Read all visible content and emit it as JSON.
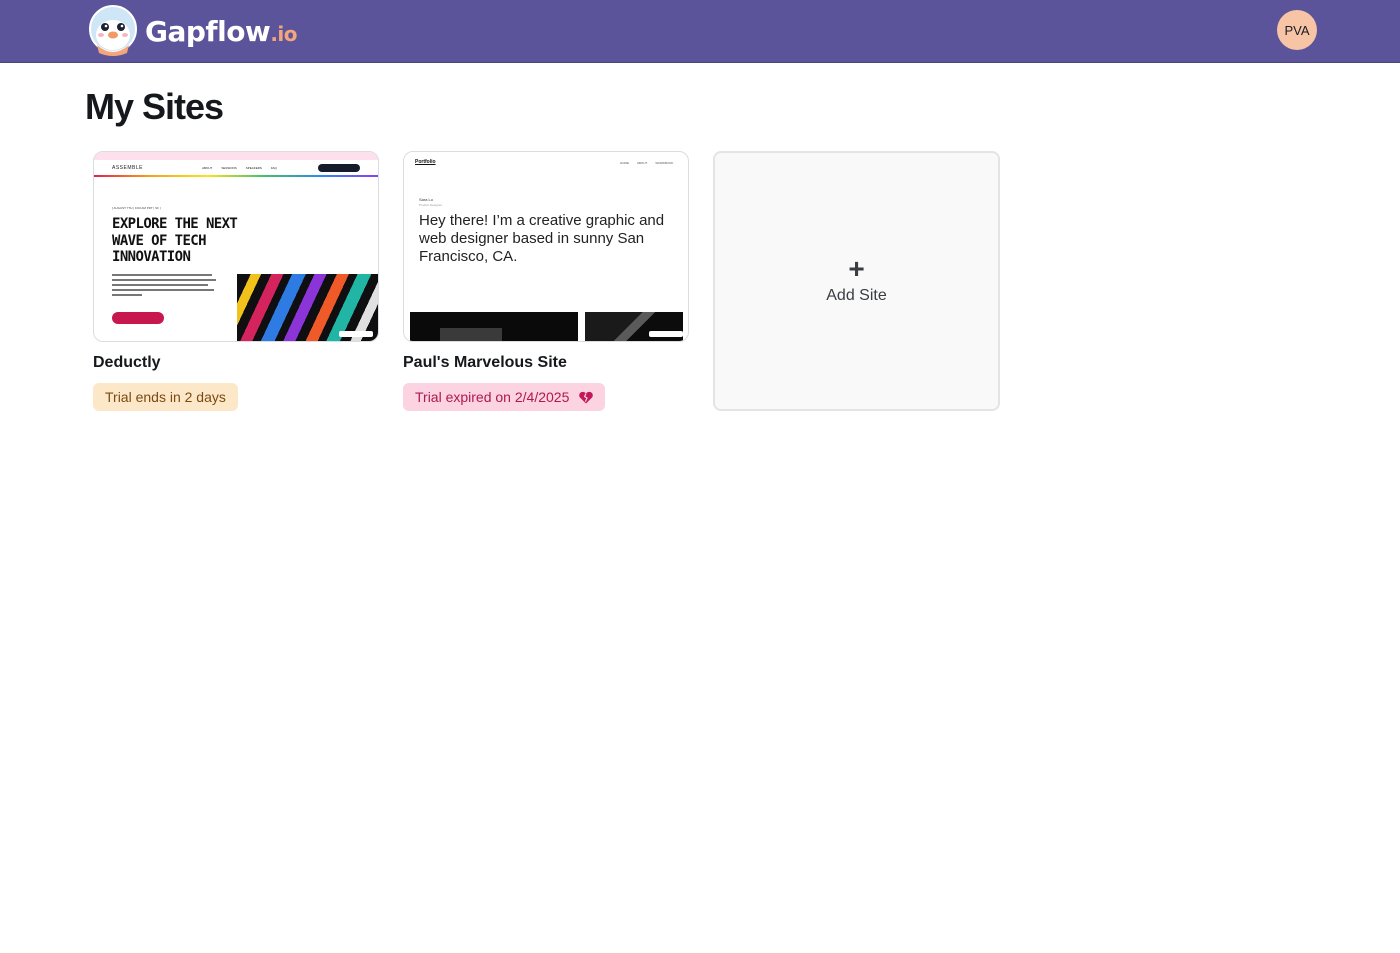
{
  "header": {
    "brand_name": "Gapflow",
    "brand_tld": ".io",
    "avatar_initials": "PVA",
    "bg_color": "#5b549a"
  },
  "page": {
    "title": "My Sites"
  },
  "sites": [
    {
      "name": "Deductly",
      "status": "Trial ends in 2 days",
      "status_type": "trial",
      "preview": {
        "logo": "ASSEMBLE",
        "nav_links": [
          "ABOUT",
          "SESSIONS",
          "SPEAKERS",
          "FAQ"
        ],
        "date": "[ AUGUST 7TH | 9:00 AM PDT | SF ]",
        "headline": "EXPLORE THE NEXT WAVE OF TECH INNOVATION"
      }
    },
    {
      "name": "Paul's Marvelous Site",
      "status": "Trial expired on 2/4/2025",
      "status_type": "expired",
      "status_icon": "broken-heart-icon",
      "preview": {
        "logo": "Portfolio",
        "nav_links": [
          "HOME",
          "ABOUT",
          "WORKBOOK"
        ],
        "name": "Sara Lo",
        "role": "Product Designer",
        "hero": "Hey there! I’m a creative graphic and web designer based in sunny San Francisco, CA."
      }
    }
  ],
  "add_site": {
    "icon": "+",
    "label": "Add Site"
  },
  "colors": {
    "trial_bg": "#fce8c9",
    "trial_text": "#7a4a10",
    "expired_bg": "#fbd3e1",
    "expired_text": "#b0184f"
  }
}
